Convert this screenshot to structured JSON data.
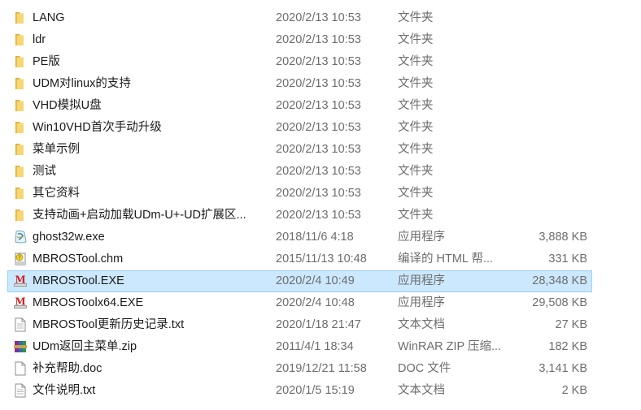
{
  "files": [
    {
      "name": "LANG",
      "date": "2020/2/13 10:53",
      "type": "文件夹",
      "size": "",
      "icon": "folder-icon",
      "selected": false
    },
    {
      "name": "ldr",
      "date": "2020/2/13 10:53",
      "type": "文件夹",
      "size": "",
      "icon": "folder-icon",
      "selected": false
    },
    {
      "name": "PE版",
      "date": "2020/2/13 10:53",
      "type": "文件夹",
      "size": "",
      "icon": "folder-icon",
      "selected": false
    },
    {
      "name": "UDM对linux的支持",
      "date": "2020/2/13 10:53",
      "type": "文件夹",
      "size": "",
      "icon": "folder-icon",
      "selected": false
    },
    {
      "name": "VHD模拟U盘",
      "date": "2020/2/13 10:53",
      "type": "文件夹",
      "size": "",
      "icon": "folder-icon",
      "selected": false
    },
    {
      "name": "Win10VHD首次手动升级",
      "date": "2020/2/13 10:53",
      "type": "文件夹",
      "size": "",
      "icon": "folder-icon",
      "selected": false
    },
    {
      "name": "菜单示例",
      "date": "2020/2/13 10:53",
      "type": "文件夹",
      "size": "",
      "icon": "folder-icon",
      "selected": false
    },
    {
      "name": "测试",
      "date": "2020/2/13 10:53",
      "type": "文件夹",
      "size": "",
      "icon": "folder-icon",
      "selected": false
    },
    {
      "name": "其它资料",
      "date": "2020/2/13 10:53",
      "type": "文件夹",
      "size": "",
      "icon": "folder-icon",
      "selected": false
    },
    {
      "name": "支持动画+启动加载UDm-U+-UD扩展区...",
      "date": "2020/2/13 10:53",
      "type": "文件夹",
      "size": "",
      "icon": "folder-icon",
      "selected": false
    },
    {
      "name": "ghost32w.exe",
      "date": "2018/11/6 4:18",
      "type": "应用程序",
      "size": "3,888 KB",
      "icon": "ghost-app-icon",
      "selected": false
    },
    {
      "name": "MBROSTool.chm",
      "date": "2015/11/13 10:48",
      "type": "编译的 HTML 帮...",
      "size": "331 KB",
      "icon": "chm-help-icon",
      "selected": false
    },
    {
      "name": "MBROSTool.EXE",
      "date": "2020/2/4 10:49",
      "type": "应用程序",
      "size": "28,348 KB",
      "icon": "mbrostool-app-icon",
      "selected": true
    },
    {
      "name": "MBROSToolx64.EXE",
      "date": "2020/2/4 10:48",
      "type": "应用程序",
      "size": "29,508 KB",
      "icon": "mbrostool-app-icon",
      "selected": false
    },
    {
      "name": "MBROSTool更新历史记录.txt",
      "date": "2020/1/18 21:47",
      "type": "文本文档",
      "size": "27 KB",
      "icon": "text-file-icon",
      "selected": false
    },
    {
      "name": "UDm返回主菜单.zip",
      "date": "2011/4/1 18:34",
      "type": "WinRAR ZIP 压缩...",
      "size": "182 KB",
      "icon": "winrar-archive-icon",
      "selected": false
    },
    {
      "name": "补充帮助.doc",
      "date": "2019/12/21 11:58",
      "type": "DOC 文件",
      "size": "3,141 KB",
      "icon": "doc-file-icon",
      "selected": false
    },
    {
      "name": "文件说明.txt",
      "date": "2020/1/5 15:19",
      "type": "文本文档",
      "size": "2 KB",
      "icon": "text-file-icon",
      "selected": false
    }
  ],
  "colors": {
    "folder": "#f2c94c",
    "selection": "#cce8ff",
    "selection_border": "#99d1ff",
    "meta_text": "#6d6d6d"
  }
}
